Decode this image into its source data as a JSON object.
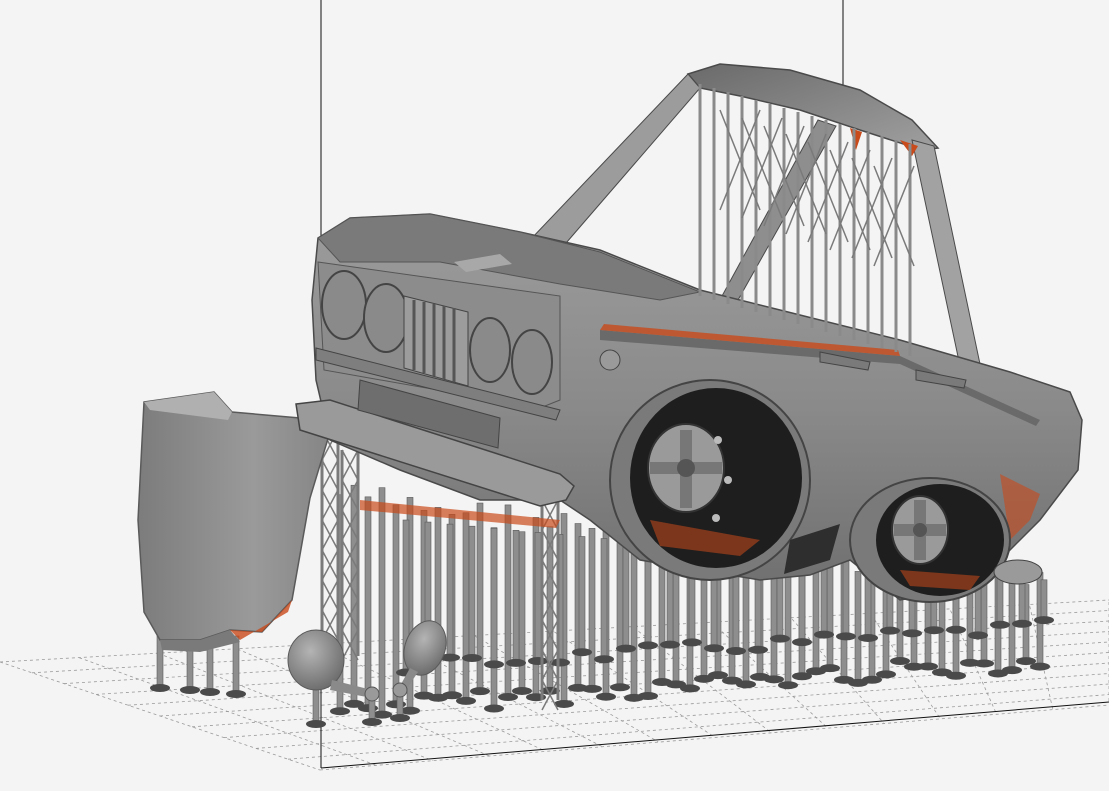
{
  "viewport": {
    "background": "#f4f4f4",
    "model_color": "#8e8e8e",
    "model_shadow": "#555555",
    "overhang_color": "#c94a1a",
    "grid_color": "#9a9a9a",
    "bounding_line_color": "#111111"
  },
  "scene": {
    "objects": [
      {
        "id": "car-body",
        "icon": "car-body-icon"
      },
      {
        "id": "hood-part",
        "icon": "hood-icon"
      },
      {
        "id": "mirror-left",
        "icon": "mirror-icon"
      },
      {
        "id": "mirror-right",
        "icon": "mirror-icon"
      }
    ],
    "supports": "support-pillar-icon"
  }
}
